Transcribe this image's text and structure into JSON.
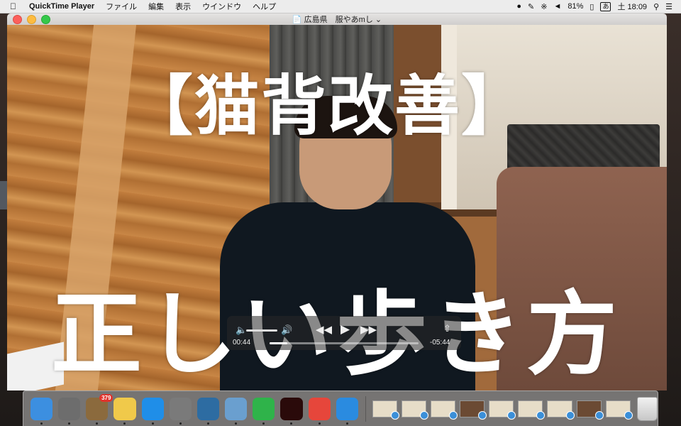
{
  "menubar": {
    "app_name": "QuickTime Player",
    "menus": [
      "ファイル",
      "編集",
      "表示",
      "ウインドウ",
      "ヘルプ"
    ],
    "battery": "81%",
    "ime": "あ",
    "clock": "土 18:09",
    "icons": [
      "creative-cloud-icon",
      "evernote-icon",
      "bluetooth-icon",
      "wifi-icon",
      "battery-icon",
      "search-icon",
      "list-icon"
    ]
  },
  "window": {
    "title": "広島県　服やあmし",
    "file_icon": "document-icon"
  },
  "video": {
    "caption_top": "【猫背改善】",
    "caption_bottom": "正しい歩き方"
  },
  "hud": {
    "current_time": "00:44",
    "remaining_time": "-05:44",
    "progress": 0.12,
    "icons": [
      "volume-low-icon",
      "volume-high-icon",
      "rewind-icon",
      "play-icon",
      "fast-forward-icon",
      "share-icon"
    ]
  },
  "dock": {
    "apps": [
      {
        "name": "finder",
        "color": "#3c8fe0"
      },
      {
        "name": "launchpad",
        "color": "#6d6d6d"
      },
      {
        "name": "mail",
        "color": "#8b6a3d",
        "badge": "379"
      },
      {
        "name": "notes",
        "color": "#f0c94a"
      },
      {
        "name": "app-store",
        "color": "#1f8ee8"
      },
      {
        "name": "system-preferences",
        "color": "#7a7a7a"
      },
      {
        "name": "quicktime",
        "color": "#2d6ca2"
      },
      {
        "name": "preview",
        "color": "#6a9fcf"
      },
      {
        "name": "evernote",
        "color": "#2fb34a"
      },
      {
        "name": "acrobat",
        "color": "#2a0a0a"
      },
      {
        "name": "chrome",
        "color": "#e6463b"
      },
      {
        "name": "safari",
        "color": "#2a8be0"
      }
    ],
    "thumbnails": 9
  }
}
